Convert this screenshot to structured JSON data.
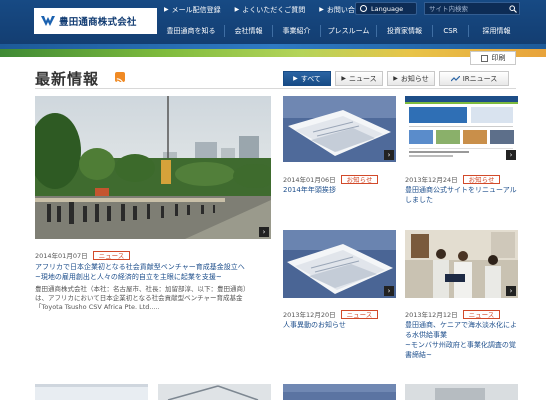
{
  "header": {
    "logo_text": "豊田通商株式会社",
    "util_links": [
      "メール配信登録",
      "よくいただくご質問",
      "お問い合わせ"
    ],
    "language_label": "Language",
    "search_placeholder": "サイト内検索",
    "nav": [
      "豊田通商を知る",
      "会社情報",
      "事業紹介",
      "プレスルーム",
      "投資家情報",
      "CSR",
      "採用情報"
    ]
  },
  "print_label": "印刷",
  "page_title": "最新情報",
  "tabs": [
    "すべて",
    "ニュース",
    "お知らせ",
    "IRニュース"
  ],
  "featured": {
    "date": "2014年01月07日",
    "badge": "ニュース",
    "headline": [
      "アフリカで日本企業初となる社会貢献型ベンチャー育成基金設立へ",
      "~現地の雇用創出と人々の経済的自立を主眼に起業を支援~"
    ],
    "desc": [
      "豊田通商株式会社（本社：名古屋市、社長：加留部淳、以下：豊田通商）",
      "は、アフリカにおいて日本企業初となる社会貢献型ベンチャー育成基金",
      "「Toyota Tsusho CSV Africa Pte. Ltd....."
    ]
  },
  "cards": [
    {
      "date": "2014年01月06日",
      "badge": "お知らせ",
      "headline": [
        "2014年年頭挨拶"
      ]
    },
    {
      "date": "2013年12月24日",
      "badge": "お知らせ",
      "headline": [
        "豊田通商公式サイトをリニューアル",
        "しました"
      ]
    },
    {
      "date": "2013年12月20日",
      "badge": "ニュース",
      "headline": [
        "人事異動のお知らせ"
      ]
    },
    {
      "date": "2013年12月12日",
      "badge": "ニュース",
      "headline": [
        "豊田通商、ケニアで海水淡水化によ",
        "る水供給事業",
        "~モンバサ州政府と事業化調査の覚",
        "書締結~"
      ]
    }
  ],
  "colors": {
    "header_bg": "#174a84",
    "link_blue": "#1e4f8c",
    "badge_red": "#d24a2a",
    "active_tab": "#1f579a",
    "rss_orange": "#f08a24"
  }
}
